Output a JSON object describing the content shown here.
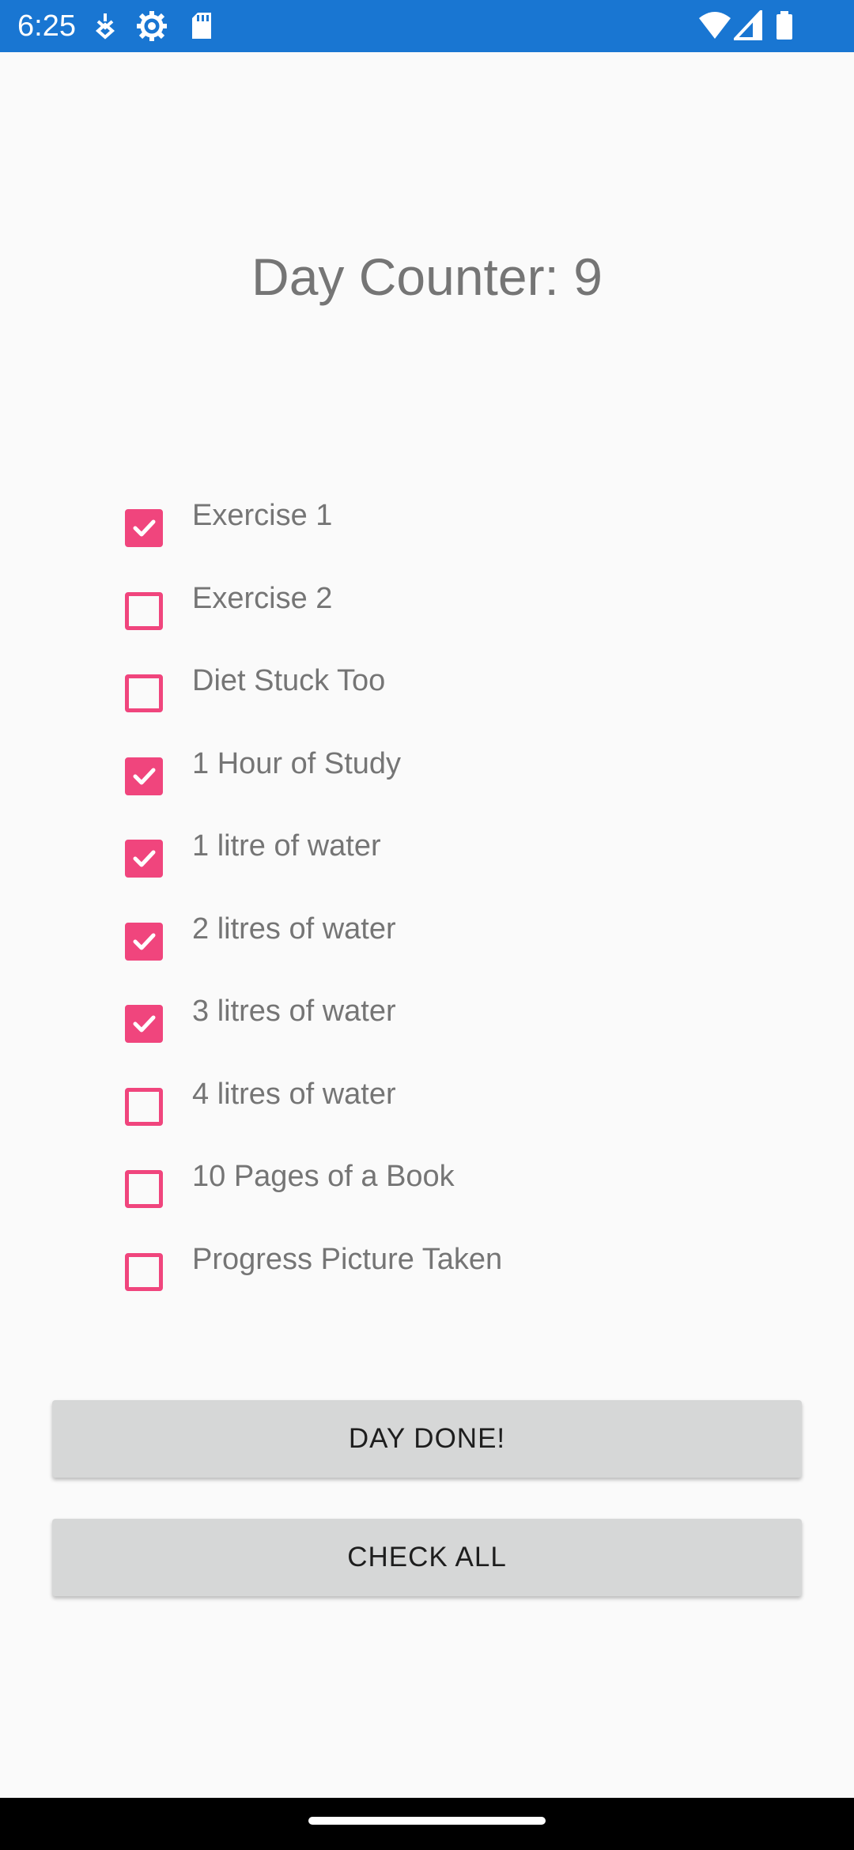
{
  "status_bar": {
    "time": "6:25",
    "background": "#1976d2",
    "icons_left": [
      "notification-icon",
      "settings-icon",
      "sd-card-icon"
    ],
    "icons_right": [
      "wifi-icon",
      "signal-icon",
      "battery-icon"
    ]
  },
  "header": {
    "day_counter": "Day Counter: 9"
  },
  "checklist": {
    "accent_color": "#f0457d",
    "items": [
      {
        "label": "Exercise 1",
        "checked": true
      },
      {
        "label": "Exercise 2",
        "checked": false
      },
      {
        "label": "Diet Stuck Too",
        "checked": false
      },
      {
        "label": "1 Hour of Study",
        "checked": true
      },
      {
        "label": "1 litre of water",
        "checked": true
      },
      {
        "label": "2 litres of water",
        "checked": true
      },
      {
        "label": "3 litres of water",
        "checked": true
      },
      {
        "label": "4 litres of water",
        "checked": false
      },
      {
        "label": "10 Pages of a Book",
        "checked": false
      },
      {
        "label": "Progress Picture Taken",
        "checked": false
      }
    ]
  },
  "buttons": {
    "day_done_label": "DAY DONE!",
    "check_all_label": "CHECK ALL"
  }
}
